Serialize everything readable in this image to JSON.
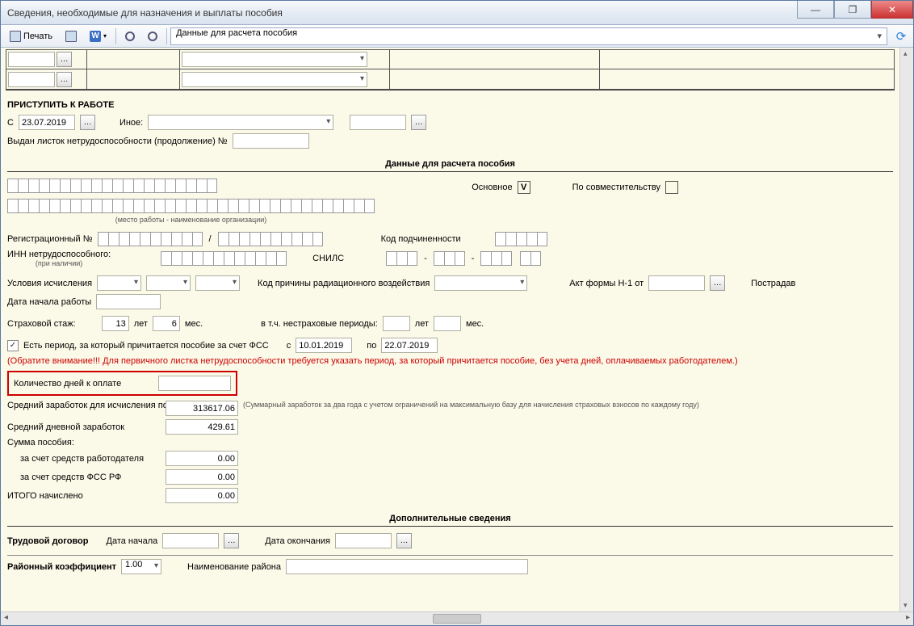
{
  "window": {
    "title": "Сведения, необходимые для назначения и выплаты пособия"
  },
  "toolbar": {
    "print_label": "Печать",
    "dropdown_value": "Данные для расчета пособия"
  },
  "return_to_work": {
    "header": "ПРИСТУПИТЬ К РАБОТЕ",
    "from_label": "С",
    "from_date": "23.07.2019",
    "other_label": "Иное:",
    "issued_label": "Выдан листок нетрудоспособности (продолжение) №"
  },
  "calc_data": {
    "header": "Данные для расчета пособия",
    "workplace_note": "(место работы - наименование организации)",
    "main_label": "Основное",
    "main_checked": "V",
    "parttime_label": "По совместительству",
    "reg_no_label": "Регистрационный №",
    "sub_code_label": "Код подчиненности",
    "inn_label": "ИНН нетрудоспособного:",
    "inn_note": "(при наличии)",
    "snils_label": "СНИЛС",
    "conditions_label": "Условия исчисления",
    "radiation_label": "Код причины радиационного воздействия",
    "act_label": "Акт формы Н-1 от",
    "affected_label": "Пострадав",
    "start_date_label": "Дата начала работы",
    "insurance_label": "Страховой стаж:",
    "years_label": "лет",
    "months_label": "мес.",
    "years_value": "13",
    "months_value": "6",
    "incl_label": "в т.ч. нестраховые периоды:",
    "fss_period_label": "Есть период, за который причитается пособие за счет ФСС",
    "period_from_label": "с",
    "period_from": "10.01.2019",
    "period_to_label": "по",
    "period_to": "22.07.2019",
    "warning": "(Обратите внимание!!! Для первичного листка нетрудоспособности требуется указать период, за который причитается пособие, без учета дней, оплачиваемых работодателем.)",
    "days_to_pay_label": "Количество дней к оплате",
    "avg_earnings_label": "Средний заработок для исчисления пособия:",
    "avg_earnings_value": "313617.06",
    "avg_earnings_note": "(Суммарный заработок за два года с учетом ограничений на максимальную базу для начисления страховых взносов по каждому году)",
    "daily_label": "Средний дневной заработок",
    "daily_value": "429.61",
    "sum_label": "Сумма пособия:",
    "employer_label": "за счет средств работодателя",
    "employer_value": "0.00",
    "fss_label": "за счет средств ФСС РФ",
    "fss_value": "0.00",
    "total_label": "ИТОГО начислено",
    "total_value": "0.00"
  },
  "additional": {
    "header": "Дополнительные сведения",
    "contract_label": "Трудовой договор",
    "start_label": "Дата начала",
    "end_label": "Дата окончания",
    "region_coef_label": "Районный коэффициент",
    "region_coef_value": "1.00",
    "region_name_label": "Наименование района"
  }
}
